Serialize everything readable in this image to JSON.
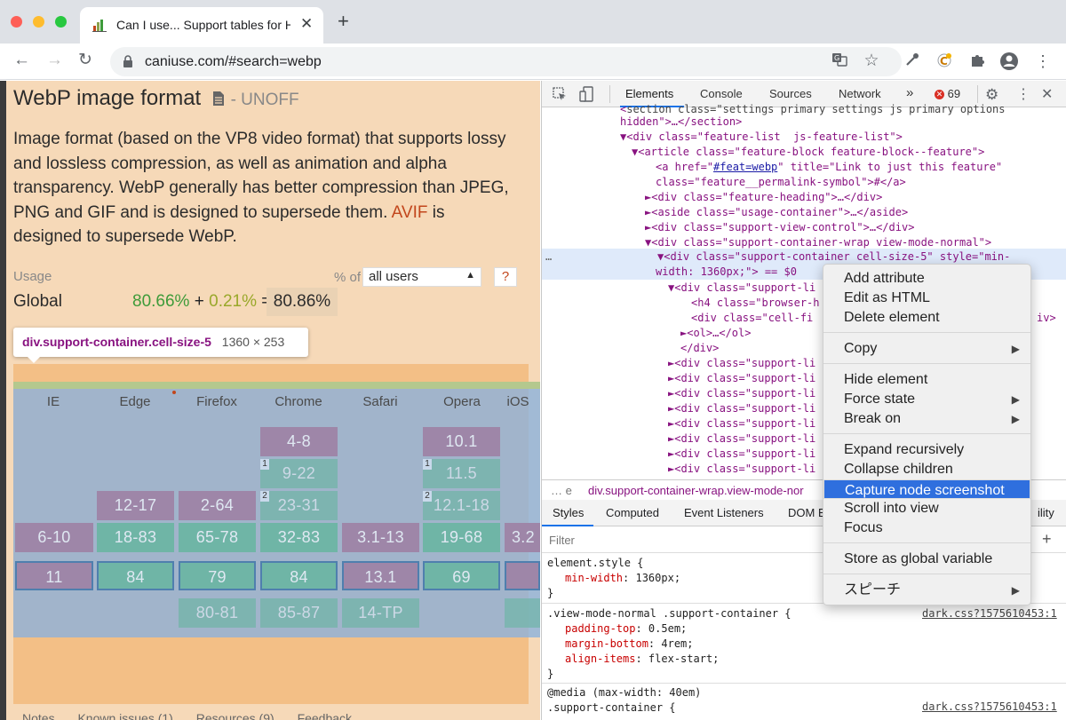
{
  "browser": {
    "tab_title": "Can I use... Support tables for H",
    "tab_close": "✕",
    "new_tab": "+",
    "url": "caniuse.com/#search=webp",
    "nav": {
      "back": "←",
      "forward": "→",
      "reload": "↻"
    },
    "toolbar_icons": [
      "translate-icon",
      "star-icon",
      "eyedropper-icon",
      "extension-c-icon",
      "puzzle-icon",
      "profile-icon",
      "more-icon"
    ]
  },
  "page": {
    "title": "WebP image format",
    "status": "- UNOFF",
    "desc_1": "Image format (based on the VP8 video format) that supports lossy and lossless compression, as well as animation and alpha transparency. WebP generally has better compression than JPEG, PNG and GIF and is designed to supersede them.",
    "desc_link": "AVIF",
    "desc_2": "is designed to supersede WebP.",
    "usage_label": "Usage",
    "pct_of": "% of",
    "users_select": "all users",
    "help": "?",
    "global_label": "Global",
    "usage_a": "80.66%",
    "plus": "+",
    "usage_b": "0.21%",
    "equals": "=",
    "usage_total": "80.86%",
    "tooltip_selector": "div.support-container.cell-size-5",
    "tooltip_size": "1360 × 253",
    "browsers": [
      "IE",
      "Edge",
      "Firefox",
      "Chrome",
      "Safari",
      "Opera",
      "iOS"
    ],
    "bottom_tabs": [
      "Notes",
      "Known issues (1)",
      "Resources (9)",
      "Feedback"
    ]
  },
  "grid": {
    "chrome": [
      "4-8",
      "9-22",
      "23-31",
      "32-83",
      "84",
      "85-87"
    ],
    "opera": [
      "10.1",
      "11.5",
      "12.1-18",
      "19-68",
      "69"
    ],
    "ie": [
      "6-10",
      "11"
    ],
    "edge": [
      "12-17",
      "18-83",
      "84"
    ],
    "firefox": [
      "2-64",
      "65-78",
      "79",
      "80-81"
    ],
    "safari": [
      "3.1-13",
      "13.1",
      "14-TP"
    ],
    "ios_partial": "3.2",
    "notes": [
      "1",
      "1",
      "2",
      "2"
    ]
  },
  "devtools": {
    "tabs": [
      "Elements",
      "Console",
      "Sources",
      "Network"
    ],
    "more_tabs": "»",
    "errors": "69",
    "dom": {
      "l0a": "section class=\"settings primary settings js primary options",
      "l0b": "hidden\">…</section>",
      "l1": "▼<div class=\"feature-list  js-feature-list\">",
      "l2": "▼<article class=\"feature-block feature-block--feature\">",
      "l3a": "<a href=\"",
      "l3href": "#feat=webp",
      "l3b": "\" title=\"Link to just this feature\"",
      "l4": "class=\"feature__permalink-symbol\">#</a>",
      "l5": "►<div class=\"feature-heading\">…</div>",
      "l6": "►<aside class=\"usage-container\">…</aside>",
      "l7": "►<div class=\"support-view-control\">…</div>",
      "l8": "▼<div class=\"support-container-wrap view-mode-normal\">",
      "l9": "▼<div class=\"support-container cell-size-5\" style=\"min-",
      "l10": "width: 1360px;\"> == $0",
      "l11": "▼<div class=\"support-li",
      "l12": "<h4 class=\"browser-h",
      "l13": "<div class=\"cell-fi",
      "l13b": "iv>",
      "l14": "►<ol>…</ol>",
      "l15": "</div>",
      "l16": "►<div class=\"support-li",
      "dots": "…"
    },
    "breadcrumb": "div.support-container-wrap.view-mode-nor",
    "breadcrumb_prefix": "…  e",
    "style_tabs": [
      "Styles",
      "Computed",
      "Event Listeners",
      "DOM B"
    ],
    "style_tab_cut": "ility",
    "filter_placeholder": "Filter",
    "css": {
      "r1_sel": "element.style {",
      "r1_p1": "min-width",
      "r1_v1": ": 1360px;",
      "close": "}",
      "r2_sel": ".view-mode-normal .support-container {",
      "r2_src": "dark.css?1575610453:1",
      "r2_p1": "padding-top",
      "r2_v1": ": 0.5em;",
      "r2_p2": "margin-bottom",
      "r2_v2": ": 4rem;",
      "r2_p3": "align-items",
      "r2_v3": ": flex-start;",
      "r3_media": "@media (max-width: 40em)",
      "r3_sel": ".support-container {",
      "r3_src": "dark.css?1575610453:1"
    }
  },
  "context_menu": {
    "items": [
      "Add attribute",
      "Edit as HTML",
      "Delete element",
      "Copy",
      "Hide element",
      "Force state",
      "Break on",
      "Expand recursively",
      "Collapse children",
      "Capture node screenshot",
      "Scroll into view",
      "Focus",
      "Store as global variable",
      "スピーチ"
    ],
    "submenu_arrow": "▶",
    "selected": "Capture node screenshot"
  },
  "colors": {
    "accent": "#1a73e8",
    "menu_highlight": "#2f6fde",
    "page_bg": "#f6d9b8",
    "overlay_blue": "#8cb2dc"
  }
}
